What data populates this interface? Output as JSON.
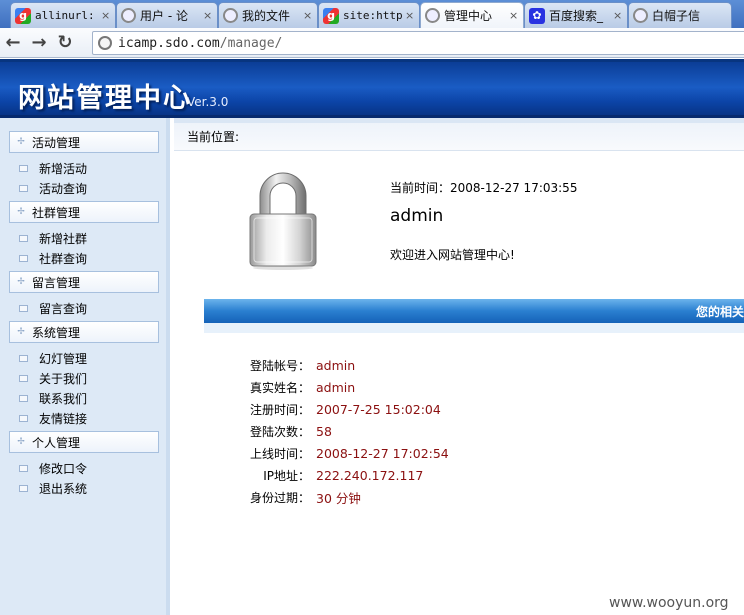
{
  "browser": {
    "tabs": [
      {
        "title": "allinurl:",
        "icon": "google",
        "mono": true,
        "active": false
      },
      {
        "title": "用户 - 论",
        "icon": "globe",
        "mono": false,
        "active": false
      },
      {
        "title": "我的文件",
        "icon": "globe",
        "mono": false,
        "active": false
      },
      {
        "title": "site:http",
        "icon": "google",
        "mono": true,
        "active": false
      },
      {
        "title": "管理中心",
        "icon": "globe",
        "mono": false,
        "active": true
      },
      {
        "title": "百度搜索_",
        "icon": "paw",
        "mono": false,
        "active": false
      },
      {
        "title": "白帽子信",
        "icon": "globe",
        "mono": false,
        "active": false
      }
    ],
    "close_glyph": "×",
    "address_host": "icamp.sdo.com",
    "address_path": "/manage/"
  },
  "header": {
    "title": "网站管理中心",
    "version": "Ver.3.0"
  },
  "sidebar": {
    "groups": [
      {
        "label": "活动管理",
        "items": [
          "新增活动",
          "活动查询"
        ]
      },
      {
        "label": "社群管理",
        "items": [
          "新增社群",
          "社群查询"
        ]
      },
      {
        "label": "留言管理",
        "items": [
          "留言查询"
        ]
      },
      {
        "label": "系统管理",
        "items": [
          "幻灯管理",
          "关于我们",
          "联系我们",
          "友情链接"
        ]
      },
      {
        "label": "个人管理",
        "items": [
          "修改口令",
          "退出系统"
        ]
      }
    ]
  },
  "main": {
    "location_label": "当前位置:",
    "current_time": "当前时间：2008-12-27 17:03:55",
    "username": "admin",
    "welcome": "欢迎进入网站管理中心!",
    "info_bar_title": "您的相关",
    "info_rows": [
      {
        "label": "登陆帐号：",
        "value": "admin"
      },
      {
        "label": "真实姓名：",
        "value": "admin"
      },
      {
        "label": "注册时间：",
        "value": "2007-7-25 15:02:04"
      },
      {
        "label": "登陆次数：",
        "value": "58"
      },
      {
        "label": "上线时间：",
        "value": "2008-12-27 17:02:54"
      },
      {
        "label": "IP地址：",
        "value": "222.240.172.117"
      },
      {
        "label": "身份过期：",
        "value": "30 分钟"
      }
    ]
  },
  "watermark": "www.wooyun.org"
}
